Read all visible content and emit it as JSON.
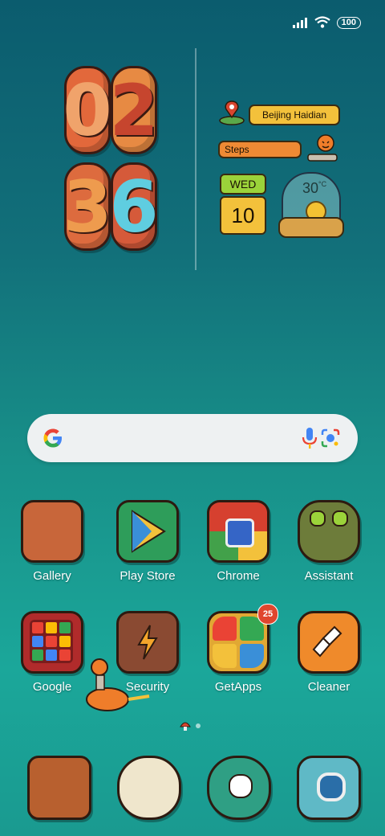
{
  "status_bar": {
    "battery": "100",
    "signal_icon": "signal-icon",
    "wifi_icon": "wifi-icon"
  },
  "clock": {
    "hour": [
      "0",
      "2"
    ],
    "minute": [
      "3",
      "6"
    ]
  },
  "widget": {
    "location": "Beijing Haidian",
    "steps_label": "Steps",
    "weekday": "WED",
    "day": "10",
    "temperature": "30",
    "temperature_unit": "°C"
  },
  "search": {
    "google_icon": "google-g-icon",
    "mic_icon": "mic-icon",
    "lens_icon": "lens-icon"
  },
  "apps_row1": [
    {
      "label": "Gallery",
      "icon": "gallery-icon",
      "color": "#c8663a"
    },
    {
      "label": "Play Store",
      "icon": "play-store-icon",
      "color": "#2e9d5a"
    },
    {
      "label": "Chrome",
      "icon": "chrome-icon",
      "color": "#d6402f"
    },
    {
      "label": "Assistant",
      "icon": "robot-assistant-icon",
      "color": "#6d7c3a"
    }
  ],
  "apps_row2": [
    {
      "label": "Google",
      "icon": "google-folder-icon",
      "color": "#b02b2b"
    },
    {
      "label": "Security",
      "icon": "security-shield-icon",
      "color": "#8a4a32"
    },
    {
      "label": "GetApps",
      "icon": "getapps-icon",
      "color": "#e1a833",
      "badge": "25"
    },
    {
      "label": "Cleaner",
      "icon": "cleaner-brush-icon",
      "color": "#ef8a2b"
    }
  ],
  "dock": [
    {
      "icon": "phone-icon",
      "color": "#b8602f"
    },
    {
      "icon": "messages-icon",
      "color": "#efe6cc"
    },
    {
      "icon": "monster-icon",
      "color": "#2f9f84"
    },
    {
      "icon": "camera-robot-icon",
      "color": "#5fb9c6"
    }
  ],
  "page_indicator": {
    "pages": 2,
    "current": 1
  }
}
